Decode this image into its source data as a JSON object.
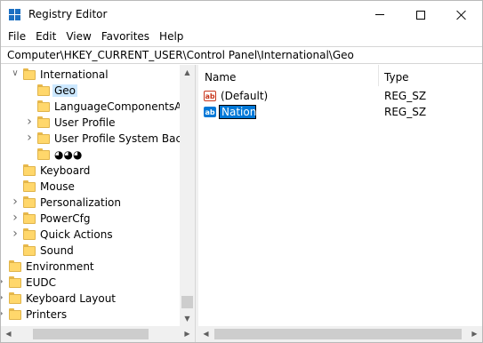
{
  "window": {
    "title": "Registry Editor"
  },
  "menu": [
    "File",
    "Edit",
    "View",
    "Favorites",
    "Help"
  ],
  "address": "Computer\\HKEY_CURRENT_USER\\Control Panel\\International\\Geo",
  "tree": [
    {
      "label": "International",
      "expander": "expanded"
    },
    {
      "label": "Geo",
      "expander": "none",
      "selected": true
    },
    {
      "label": "LanguageComponentsAv",
      "expander": "none"
    },
    {
      "label": "User Profile",
      "expander": "collapsed"
    },
    {
      "label": "User Profile System Backu",
      "expander": "collapsed"
    },
    {
      "label": "◕◕◕",
      "expander": "none"
    },
    {
      "label": "Keyboard",
      "expander": "none"
    },
    {
      "label": "Mouse",
      "expander": "none"
    },
    {
      "label": "Personalization",
      "expander": "collapsed"
    },
    {
      "label": "PowerCfg",
      "expander": "collapsed"
    },
    {
      "label": "Quick Actions",
      "expander": "collapsed"
    },
    {
      "label": "Sound",
      "expander": "none"
    },
    {
      "label": "Environment",
      "expander": "none"
    },
    {
      "label": "EUDC",
      "expander": "collapsed"
    },
    {
      "label": "Keyboard Layout",
      "expander": "collapsed"
    },
    {
      "label": "Printers",
      "expander": "collapsed"
    }
  ],
  "columns": {
    "name": "Name",
    "type": "Type"
  },
  "values": [
    {
      "name": "(Default)",
      "type": "REG_SZ",
      "icon": "string-value-icon"
    },
    {
      "name": "Nation",
      "type": "REG_SZ",
      "icon": "string-value-icon",
      "editing": true
    }
  ],
  "icon_text": "ab",
  "colors": {
    "selection": "#0078d7",
    "tree_selection": "#cce8ff",
    "folder": "#ffd76b"
  }
}
